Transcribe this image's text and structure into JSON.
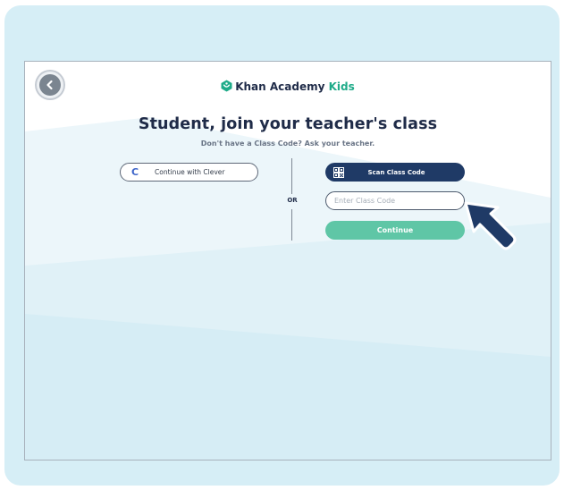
{
  "logo": {
    "brand": "Khan Academy",
    "product": "Kids",
    "brand_color": "#1fab89"
  },
  "page": {
    "title": "Student, join your teacher's class",
    "subtitle": "Don't have a Class Code? Ask your teacher."
  },
  "clever": {
    "icon_letter": "C",
    "label": "Continue with Clever"
  },
  "divider": {
    "label": "OR"
  },
  "scan": {
    "icon": "qr-code-icon",
    "label": "Scan Class Code"
  },
  "class_code": {
    "placeholder": "Enter Class Code",
    "value": ""
  },
  "continue": {
    "label": "Continue"
  },
  "colors": {
    "navy": "#1f2b48",
    "scan_button": "#1f3a66",
    "continue_button": "#5fc6a6",
    "frame_background": "#d6eef6"
  },
  "icons": {
    "back": "chevron-left-icon",
    "logo": "khan-hexagon-icon",
    "pointer": "arrow-pointer-icon"
  }
}
